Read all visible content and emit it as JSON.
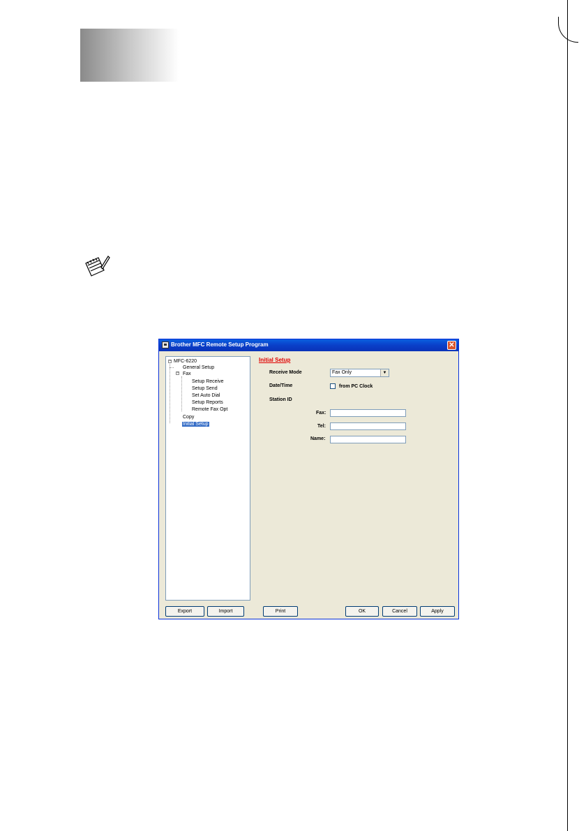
{
  "window": {
    "title": "Brother MFC Remote Setup Program",
    "close_glyph": "✕"
  },
  "tree": {
    "root": "MFC-6220",
    "items": [
      {
        "label": "General Setup"
      },
      {
        "label": "Fax"
      },
      {
        "label": "Setup Receive"
      },
      {
        "label": "Setup Send"
      },
      {
        "label": "Set Auto Dial"
      },
      {
        "label": "Setup Reports"
      },
      {
        "label": "Remote Fax Opt"
      },
      {
        "label": "Copy"
      },
      {
        "label": "Initial Setup"
      }
    ],
    "selected": "Initial Setup"
  },
  "panel": {
    "title": "Initial Setup",
    "receive_mode_label": "Receive Mode",
    "receive_mode_value": "Fax Only",
    "datetime_label": "Date/Time",
    "from_pc_clock_label": "from PC Clock",
    "station_id_label": "Station ID",
    "fax_label": "Fax:",
    "tel_label": "Tel:",
    "name_label": "Name:",
    "fax_value": "",
    "tel_value": "",
    "name_value": ""
  },
  "buttons": {
    "export": "Export",
    "import": "Import",
    "print": "Print",
    "ok": "OK",
    "cancel": "Cancel",
    "apply": "Apply"
  },
  "icons": {
    "note": "note-pad-icon",
    "app": "printer-app-icon",
    "dropdown": "chevron-down-icon"
  }
}
